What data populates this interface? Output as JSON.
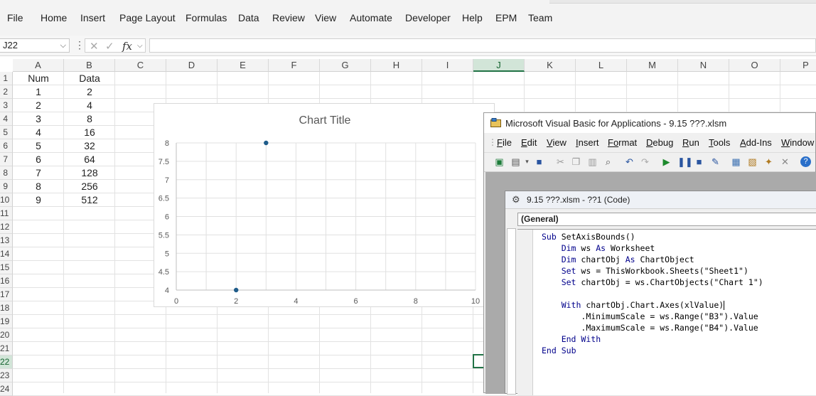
{
  "ribbon": {
    "tabs": [
      "File",
      "Home",
      "Insert",
      "Page Layout",
      "Formulas",
      "Data",
      "Review",
      "View",
      "Automate",
      "Developer",
      "Help",
      "EPM",
      "Team"
    ]
  },
  "formula_bar": {
    "name_box": "J22",
    "fx_label": "fx",
    "formula": ""
  },
  "sheet": {
    "columns": [
      "A",
      "B",
      "C",
      "D",
      "E",
      "F",
      "G",
      "H",
      "I",
      "J",
      "K",
      "L",
      "M",
      "N",
      "O",
      "P"
    ],
    "selected_column": "J",
    "rows": [
      "1",
      "2",
      "3",
      "4",
      "5",
      "6",
      "7",
      "8",
      "9",
      "10",
      "11",
      "12",
      "13",
      "14",
      "15",
      "16",
      "17",
      "18",
      "19",
      "20",
      "21",
      "22",
      "23",
      "24"
    ],
    "selected_row": "22",
    "header_row": [
      "Num",
      "Data"
    ],
    "data": [
      [
        "1",
        "2"
      ],
      [
        "2",
        "4"
      ],
      [
        "3",
        "8"
      ],
      [
        "4",
        "16"
      ],
      [
        "5",
        "32"
      ],
      [
        "6",
        "64"
      ],
      [
        "7",
        "128"
      ],
      [
        "8",
        "256"
      ],
      [
        "9",
        "512"
      ]
    ]
  },
  "chart_data": {
    "type": "scatter",
    "title": "Chart Title",
    "series": [
      {
        "x": [
          1,
          2,
          3,
          4,
          5,
          6,
          7,
          8,
          9
        ],
        "values": [
          2,
          4,
          8,
          16,
          32,
          64,
          128,
          256,
          512
        ]
      }
    ],
    "visible_points": [
      {
        "x": 2,
        "y": 4
      },
      {
        "x": 3,
        "y": 8
      }
    ],
    "xlim": [
      0,
      10
    ],
    "ylim": [
      4,
      8
    ],
    "x_ticks": [
      "0",
      "2",
      "4",
      "6",
      "8",
      "10"
    ],
    "y_ticks": [
      "4",
      "4.5",
      "5",
      "5.5",
      "6",
      "6.5",
      "7",
      "7.5",
      "8"
    ],
    "grid": true,
    "marker_color": "#1f5c8a"
  },
  "vba": {
    "title": "Microsoft Visual Basic for Applications - 9.15  ???.xlsm",
    "menu": [
      {
        "u": "F",
        "rest": "ile"
      },
      {
        "u": "E",
        "rest": "dit"
      },
      {
        "u": "V",
        "rest": "iew"
      },
      {
        "u": "I",
        "rest": "nsert"
      },
      {
        "u": "Fo",
        "rest": "rmat"
      },
      {
        "u": "D",
        "rest": "ebug"
      },
      {
        "u": "R",
        "rest": "un"
      },
      {
        "u": "T",
        "rest": "ools"
      },
      {
        "u": "A",
        "rest": "dd-Ins"
      },
      {
        "u": "W",
        "rest": "indow"
      }
    ],
    "code_window_title": "9.15  ???.xlsm - ??1 (Code)",
    "procedure_combo": "(General)",
    "code": [
      "Sub SetAxisBounds()",
      "    Dim ws As Worksheet",
      "    Dim chartObj As ChartObject",
      "    Set ws = ThisWorkbook.Sheets(\"Sheet1\")",
      "    Set chartObj = ws.ChartObjects(\"Chart 1\")",
      "",
      "    With chartObj.Chart.Axes(xlValue)",
      "        .MinimumScale = ws.Range(\"B3\").Value",
      "        .MaximumScale = ws.Range(\"B4\").Value",
      "    End With",
      "End Sub"
    ]
  }
}
